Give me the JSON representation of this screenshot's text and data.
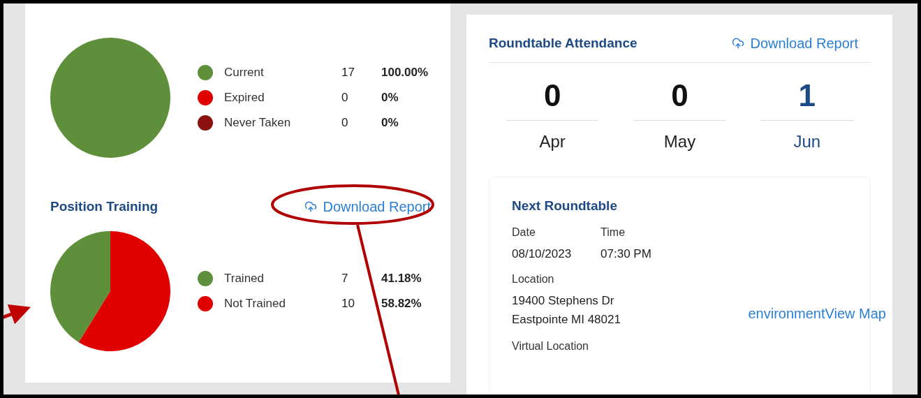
{
  "training": [
    {
      "chart_data": {
        "type": "pie",
        "categories": [
          "Current",
          "Expired",
          "Never Taken"
        ],
        "values": [
          100,
          0,
          0
        ]
      },
      "legend": [
        {
          "count": "17",
          "percent": "100.00%",
          "color": "#5e8f3a"
        },
        {
          "count": "0",
          "percent": "0%",
          "color": "#e00000"
        },
        {
          "count": "0",
          "percent": "0%",
          "color": "#8b1010"
        }
      ]
    },
    {
      "title": "Position Training",
      "download": "Download Report",
      "chart_data": {
        "type": "pie",
        "categories": [
          "Trained",
          "Not Trained"
        ],
        "values": [
          41.18,
          58.82
        ]
      },
      "legend": [
        {
          "count": "7",
          "percent": "41.18%",
          "color": "#5e8f3a"
        },
        {
          "count": "10",
          "percent": "58.82%",
          "color": "#e00000"
        }
      ]
    }
  ],
  "attendance": {
    "title": "Roundtable Attendance",
    "download": "Download Report",
    "months": [
      {
        "count": "0",
        "month": "Apr",
        "selected": false
      },
      {
        "count": "0",
        "month": "May",
        "selected": false
      },
      {
        "count": "1",
        "month": "Jun",
        "selected": true
      }
    ]
  },
  "next_roundtable": {
    "title": "Next Roundtable",
    "date_label": "Date",
    "date": "08/10/2023",
    "time_label": "Time",
    "time": "07:30 PM",
    "location_label": "Location",
    "address_lines": [
      "19400 Stephens Dr",
      "Eastpointe MI 48021"
    ],
    "map_link": "environmentView Map",
    "virtual_label": "Virtual Location"
  }
}
